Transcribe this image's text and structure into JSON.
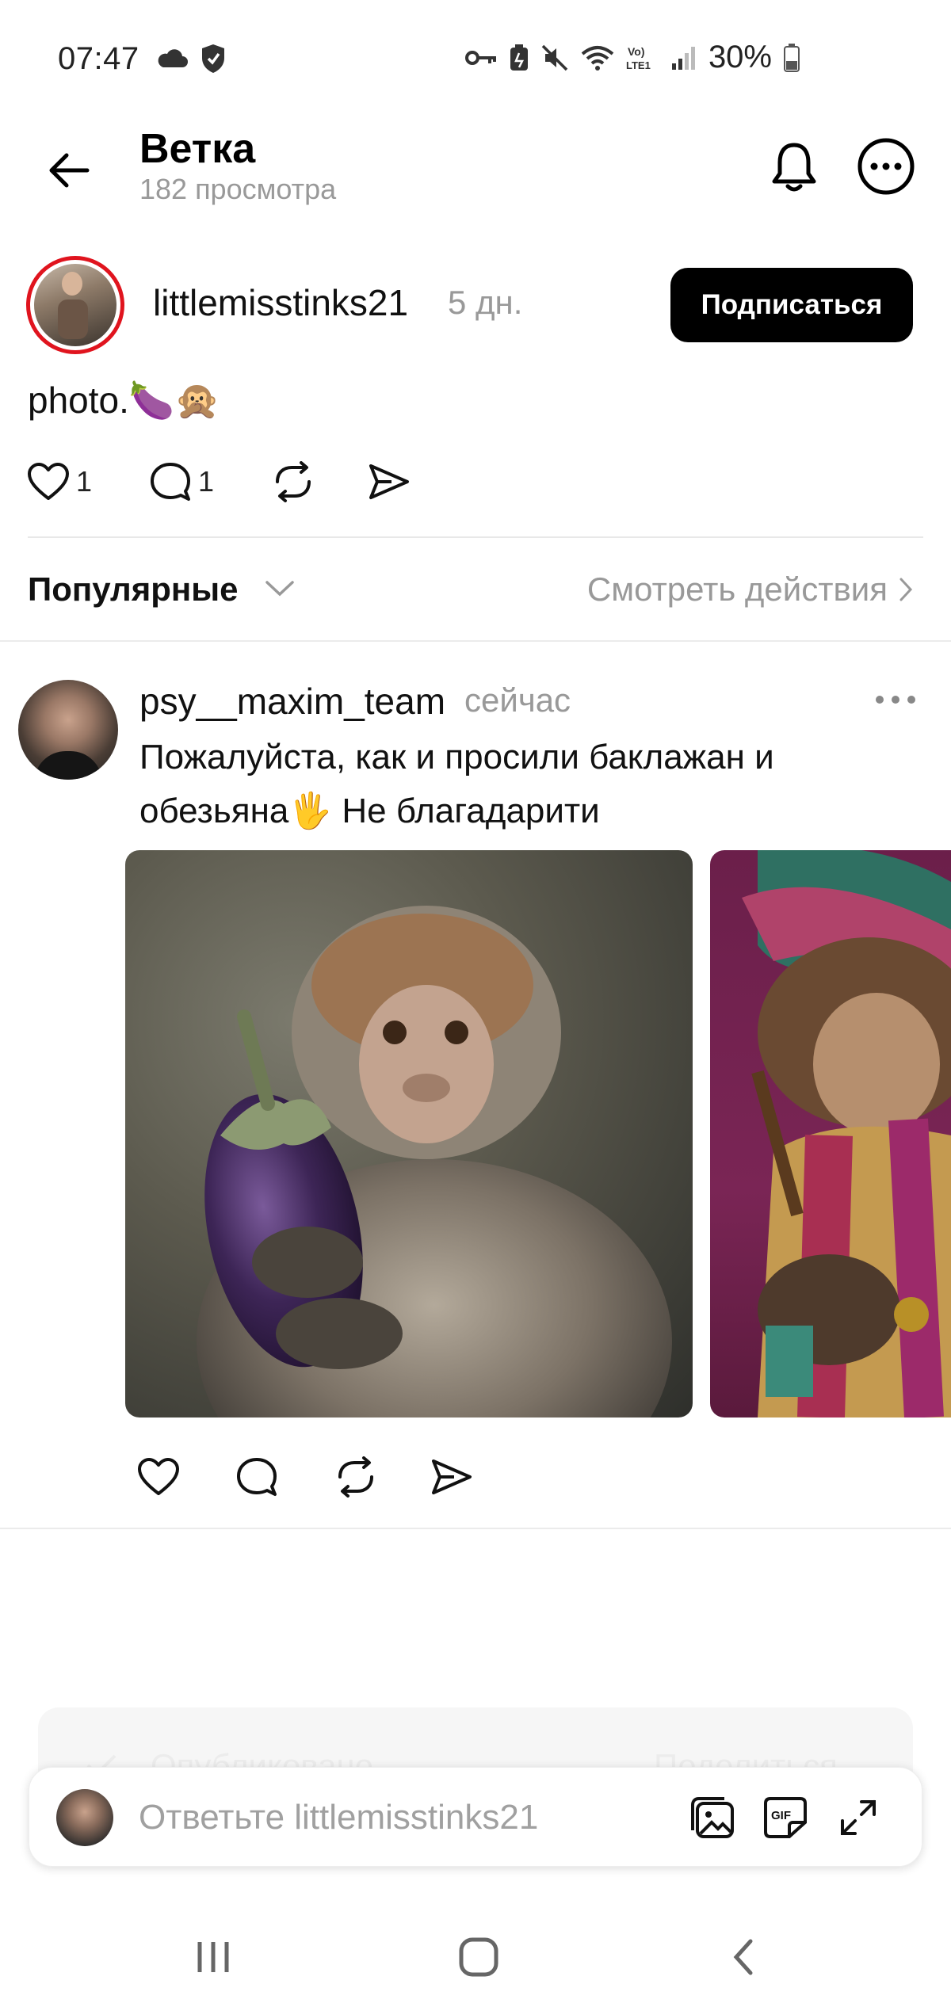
{
  "status_bar": {
    "time": "07:47",
    "battery_percent": "30%",
    "icons": [
      "cloud-icon",
      "shield-icon",
      "key-icon",
      "battery-saver-icon",
      "mute-icon",
      "wifi-icon",
      "volte-icon",
      "signal-icon",
      "battery-icon"
    ]
  },
  "header": {
    "title": "Ветка",
    "subtitle": "182 просмотра"
  },
  "original_post": {
    "username": "littlemisstinks21",
    "time": "5 дн.",
    "follow_label": "Подписаться",
    "text": "photo.🍆🙊",
    "like_count": "1",
    "comment_count": "1"
  },
  "sort": {
    "label": "Популярные",
    "activity_link": "Смотреть действия"
  },
  "reply": {
    "username": "psy__maxim_team",
    "time": "сейчас",
    "text": "Пожалуйста, как и просили баклажан и обезьяна🖐 Не благадарити"
  },
  "toast": {
    "posted_label": "Опубликовано",
    "share_label": "Поделиться"
  },
  "reply_bar": {
    "placeholder": "Ответьте littlemisstinks21"
  },
  "colors": {
    "story_ring": "#e0141e",
    "follow_button_bg": "#000000",
    "muted_text": "#999999"
  }
}
